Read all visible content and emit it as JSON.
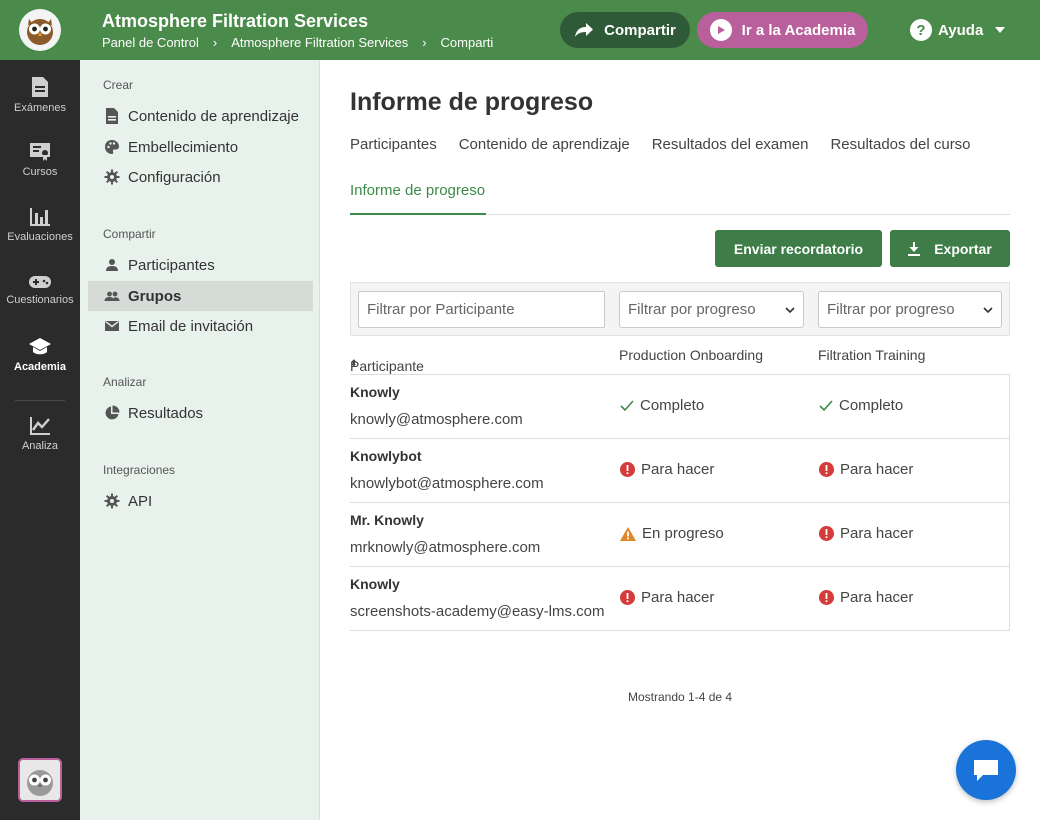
{
  "header": {
    "app_title": "Atmosphere Filtration Services",
    "breadcrumb": [
      "Panel de Control",
      "Atmosphere Filtration Services",
      "Comparti"
    ],
    "share_label": "Compartir",
    "academy_label": "Ir a la Academia",
    "help_label": "Ayuda",
    "colors": {
      "bar": "#4a8a4a",
      "share": "#2f5a38",
      "academy": "#b85f9c"
    }
  },
  "rail": {
    "items": [
      {
        "label": "Exámenes",
        "icon": "document-icon"
      },
      {
        "label": "Cursos",
        "icon": "certificate-icon"
      },
      {
        "label": "Evaluaciones",
        "icon": "bar-chart-icon"
      },
      {
        "label": "Cuestionarios",
        "icon": "gamepad-icon"
      },
      {
        "label": "Academia",
        "icon": "graduation-cap-icon",
        "active": true
      },
      {
        "label": "Analiza",
        "icon": "line-chart-icon"
      }
    ]
  },
  "sidebar": {
    "sections": [
      {
        "heading": "Crear",
        "items": [
          {
            "label": "Contenido de aprendizaje",
            "icon": "file-icon"
          },
          {
            "label": "Embellecimiento",
            "icon": "palette-icon"
          },
          {
            "label": "Configuración",
            "icon": "gear-icon"
          }
        ]
      },
      {
        "heading": "Compartir",
        "items": [
          {
            "label": "Participantes",
            "icon": "person-icon"
          },
          {
            "label": "Grupos",
            "icon": "group-icon",
            "active": true
          },
          {
            "label": "Email de invitación",
            "icon": "mail-icon"
          }
        ]
      },
      {
        "heading": "Analizar",
        "items": [
          {
            "label": "Resultados",
            "icon": "pie-chart-icon"
          }
        ]
      },
      {
        "heading": "Integraciones",
        "items": [
          {
            "label": "API",
            "icon": "gear-icon"
          }
        ]
      }
    ]
  },
  "main": {
    "title": "Informe de progreso",
    "tabs": [
      "Participantes",
      "Contenido de aprendizaje",
      "Resultados del examen",
      "Resultados del curso"
    ],
    "active_tab": "Informe de progreso",
    "remind_button": "Enviar recordatorio",
    "export_button": "Exportar",
    "filters": {
      "participant_placeholder": "Filtrar por Participante",
      "progress_1": "Filtrar por progreso",
      "progress_2": "Filtrar por progreso"
    },
    "columns": [
      "Participante",
      "Production Onboarding",
      "Filtration Training"
    ],
    "rows": [
      {
        "name": "Knowly",
        "email": "knowly@atmosphere.com",
        "s1": "Completo",
        "s1_icon": "check-icon",
        "s2": "Completo",
        "s2_icon": "check-icon"
      },
      {
        "name": "Knowlybot",
        "email": "knowlybot@atmosphere.com",
        "s1": "Para hacer",
        "s1_icon": "alert-circle-icon",
        "s2": "Para hacer",
        "s2_icon": "alert-circle-icon"
      },
      {
        "name": "Mr. Knowly",
        "email": "mrknowly@atmosphere.com",
        "s1": "En progreso",
        "s1_icon": "warning-triangle-icon",
        "s2": "Para hacer",
        "s2_icon": "alert-circle-icon"
      },
      {
        "name": "Knowly",
        "email": "screenshots-academy@easy-lms.com",
        "s1": "Para hacer",
        "s1_icon": "alert-circle-icon",
        "s2": "Para hacer",
        "s2_icon": "alert-circle-icon"
      }
    ],
    "paging": "Mostrando 1-4 de 4"
  },
  "colors": {
    "accent": "#3e8a4a",
    "danger": "#d43b3b",
    "warning": "#e0872a",
    "chat": "#1a73d9"
  }
}
